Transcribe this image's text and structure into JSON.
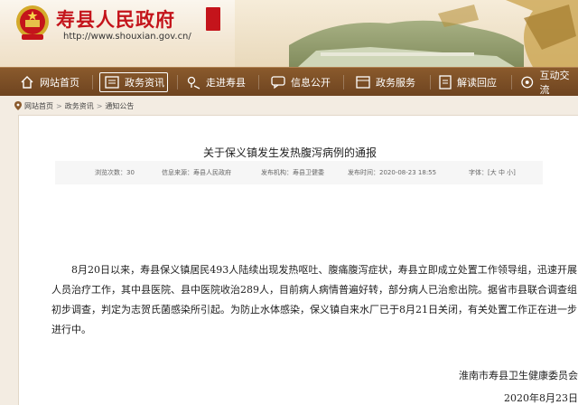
{
  "header": {
    "site_title": "寿县人民政府",
    "site_url": "http://www.shouxian.gov.cn/",
    "seal_text": "寿县 人民 政府"
  },
  "nav": {
    "items": [
      {
        "label": "网站首页",
        "icon": "home-icon"
      },
      {
        "label": "政务资讯",
        "icon": "news-icon",
        "active": true
      },
      {
        "label": "走进寿县",
        "icon": "map-pin-icon"
      },
      {
        "label": "信息公开",
        "icon": "chat-icon"
      },
      {
        "label": "政务服务",
        "icon": "services-icon"
      },
      {
        "label": "解读回应",
        "icon": "document-icon"
      },
      {
        "label": "互动交流",
        "icon": "interact-icon"
      }
    ]
  },
  "breadcrumb": {
    "items": [
      "网站首页",
      "政务资讯",
      "通知公告"
    ],
    "separator": ">"
  },
  "article": {
    "title": "关于保义镇发生发热腹泻病例的通报",
    "meta": {
      "views": "浏览次数：30",
      "source": "信息来源：寿县人民政府",
      "publisher": "发布机构：寿县卫健委",
      "date": "发布时间：2020-08-23 18:55",
      "font_size": "字体：[大 中 小]"
    },
    "body": "8月20日以来，寿县保义镇居民493人陆续出现发热呕吐、腹痛腹泻症状，寿县立即成立处置工作领导组，迅速开展人员治疗工作，其中县医院、县中医院收治289人，目前病人病情普遍好转，部分病人已治愈出院。据省市县联合调查组初步调查，判定为志贺氏菌感染所引起。为防止水体感染，保义镇自来水厂已于8月21日关闭，有关处置工作正在进一步进行中。",
    "signature": "淮南市寿县卫生健康委员会",
    "sign_date": "2020年8月23日"
  },
  "colors": {
    "brand_red": "#c4141b",
    "nav_brown": "#7a4d25",
    "page_bg": "#f3ece2"
  }
}
